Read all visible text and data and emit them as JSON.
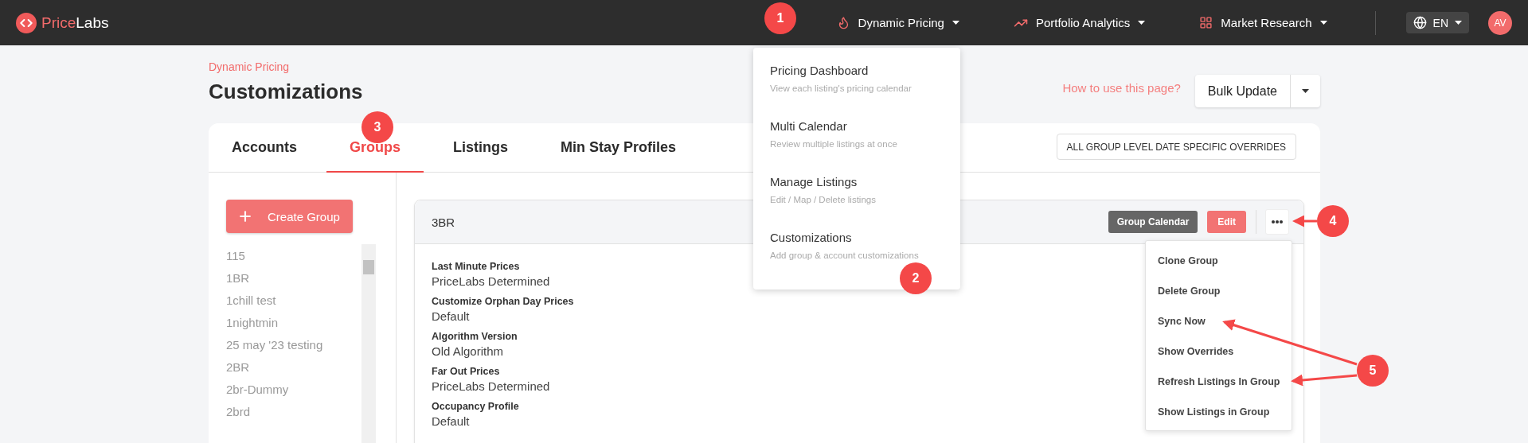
{
  "brand": {
    "part1": "Price",
    "part2": "Labs"
  },
  "nav": [
    {
      "label": "Dynamic Pricing"
    },
    {
      "label": "Portfolio Analytics"
    },
    {
      "label": "Market Research"
    }
  ],
  "language": "EN",
  "avatar": "AV",
  "nav_menu": [
    {
      "title": "Pricing Dashboard",
      "subtitle": "View each listing's pricing calendar"
    },
    {
      "title": "Multi Calendar",
      "subtitle": "Review multiple listings at once"
    },
    {
      "title": "Manage Listings",
      "subtitle": "Edit / Map / Delete listings"
    },
    {
      "title": "Customizations",
      "subtitle": "Add group & account customizations"
    }
  ],
  "breadcrumb": "Dynamic Pricing",
  "title": "Customizations",
  "help_link": "How to use this page?",
  "bulk_update": "Bulk Update",
  "tabs": [
    {
      "label": "Accounts",
      "selected": false
    },
    {
      "label": "Groups",
      "selected": true
    },
    {
      "label": "Listings",
      "selected": false
    },
    {
      "label": "Min Stay Profiles",
      "selected": false
    }
  ],
  "overrides_button": "ALL GROUP LEVEL DATE SPECIFIC OVERRIDES",
  "create_group": "Create Group",
  "groups": [
    "115",
    "1BR",
    "1chill test",
    "1nightmin",
    "25 may '23 testing",
    "2BR",
    "2br-Dummy",
    "2brd"
  ],
  "group": {
    "name": "3BR",
    "calendar_button": "Group Calendar",
    "edit_button": "Edit",
    "fields": [
      {
        "label": "Last Minute Prices",
        "value": "PriceLabs Determined"
      },
      {
        "label": "Customize Orphan Day Prices",
        "value": "Default"
      },
      {
        "label": "Algorithm Version",
        "value": "Old Algorithm"
      },
      {
        "label": "Far Out Prices",
        "value": "PriceLabs Determined"
      },
      {
        "label": "Occupancy Profile",
        "value": "Default"
      }
    ]
  },
  "actions_menu": [
    "Clone Group",
    "Delete Group",
    "Sync Now",
    "Show Overrides",
    "Refresh Listings In Group",
    "Show Listings in Group"
  ],
  "annotations": [
    "1",
    "2",
    "3",
    "4",
    "5"
  ]
}
